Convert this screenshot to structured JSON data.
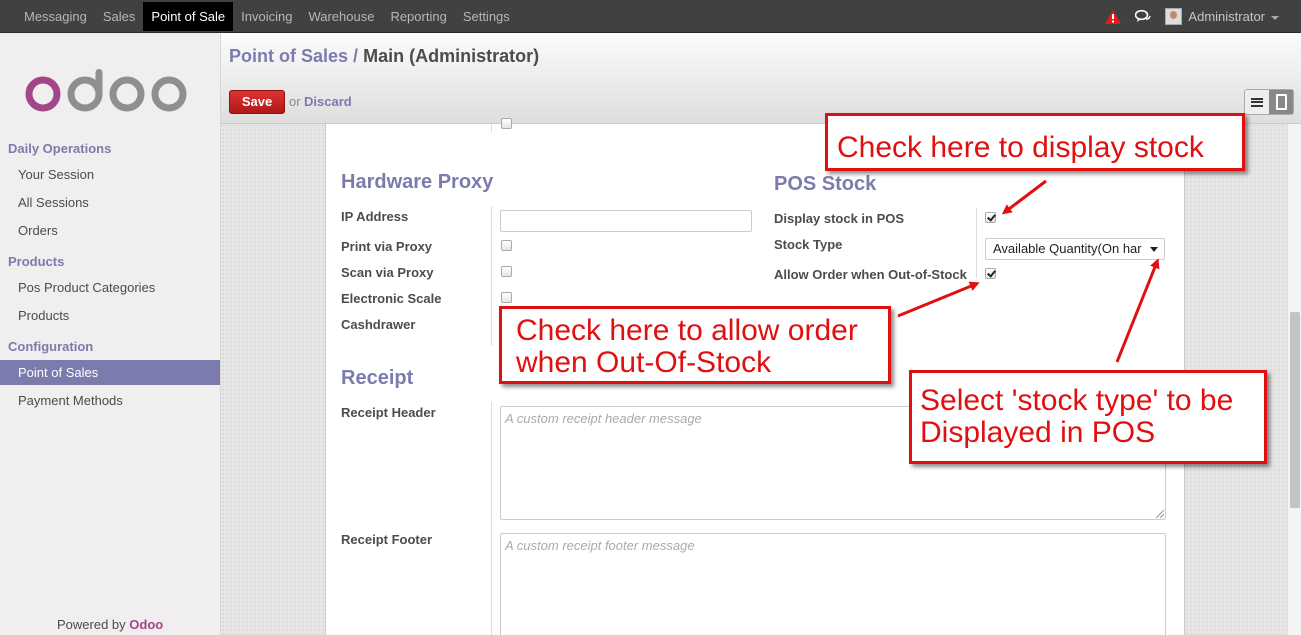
{
  "topbar": {
    "menu": [
      "Messaging",
      "Sales",
      "Point of Sale",
      "Invoicing",
      "Warehouse",
      "Reporting",
      "Settings"
    ],
    "active_menu": "Point of Sale",
    "user": "Administrator"
  },
  "sidebar": {
    "logo_text": "odoo",
    "sections": [
      {
        "title": "Daily Operations",
        "items": [
          "Your Session",
          "All Sessions",
          "Orders"
        ]
      },
      {
        "title": "Products",
        "items": [
          "Pos Product Categories",
          "Products"
        ]
      },
      {
        "title": "Configuration",
        "items": [
          "Point of Sales",
          "Payment Methods"
        ]
      }
    ],
    "active_item": "Point of Sales",
    "powered_prefix": "Powered by",
    "powered_brand": "Odoo"
  },
  "header": {
    "breadcrumb_link": "Point of Sales",
    "breadcrumb_sep": "/",
    "breadcrumb_current": "Main (Administrator)",
    "save_label": "Save",
    "or_text": "or",
    "discard_label": "Discard"
  },
  "form": {
    "hardware_title": "Hardware Proxy",
    "hardware_fields": [
      {
        "label": "IP Address",
        "type": "text",
        "value": ""
      },
      {
        "label": "Print via Proxy",
        "type": "checkbox",
        "checked": false
      },
      {
        "label": "Scan via Proxy",
        "type": "checkbox",
        "checked": false
      },
      {
        "label": "Electronic Scale",
        "type": "checkbox",
        "checked": false
      },
      {
        "label": "Cashdrawer",
        "type": "checkbox",
        "checked": false
      }
    ],
    "stock_title": "POS Stock",
    "stock_fields": [
      {
        "label": "Display stock in POS",
        "type": "checkbox",
        "checked": true
      },
      {
        "label": "Stock Type",
        "type": "select",
        "value": "Available Quantity(On har"
      },
      {
        "label": "Allow Order when Out-of-Stock",
        "type": "checkbox",
        "checked": true
      }
    ],
    "receipt_title": "Receipt",
    "receipt_header_label": "Receipt Header",
    "receipt_header_placeholder": "A custom receipt header message",
    "receipt_footer_label": "Receipt Footer",
    "receipt_footer_placeholder": "A custom receipt footer message"
  },
  "annotations": {
    "display_stock": "Check here to display stock",
    "allow_order_line1": "Check here to allow order",
    "allow_order_line2": "when Out-Of-Stock",
    "stock_type_line1": "Select 'stock type' to be",
    "stock_type_line2": "Displayed in POS"
  },
  "colors": {
    "accent": "#7c7bad",
    "save_button": "#c9202a",
    "topbar": "#414141",
    "annotation": "#e01010"
  },
  "icons": [
    "warning-icon",
    "chat-icon",
    "list-view-icon",
    "form-view-icon"
  ]
}
